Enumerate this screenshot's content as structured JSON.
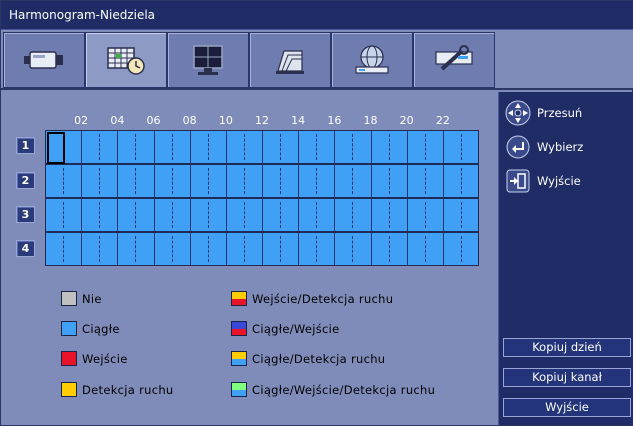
{
  "window": {
    "title": "Harmonogram-Niedziela"
  },
  "tabs": [
    {
      "icon": "camera-icon",
      "active": false
    },
    {
      "icon": "schedule-icon",
      "active": true
    },
    {
      "icon": "monitor-icon",
      "active": false
    },
    {
      "icon": "storage-icon",
      "active": false
    },
    {
      "icon": "network-icon",
      "active": false
    },
    {
      "icon": "tools-icon",
      "active": false
    }
  ],
  "schedule": {
    "hour_labels": [
      "02",
      "04",
      "06",
      "08",
      "10",
      "12",
      "14",
      "16",
      "18",
      "20",
      "22"
    ],
    "channels": [
      "1",
      "2",
      "3",
      "4"
    ],
    "fill_color": "#3fa0f5"
  },
  "legend": [
    {
      "label": "Nie",
      "colors": [
        "#c0c0c0"
      ]
    },
    {
      "label": "Ciągłe",
      "colors": [
        "#3fa0f5"
      ]
    },
    {
      "label": "Wejście",
      "colors": [
        "#e8142a"
      ]
    },
    {
      "label": "Detekcja  ruchu",
      "colors": [
        "#ffcc00"
      ]
    },
    {
      "label": "Wejście/Detekcja  ruchu",
      "colors": [
        "#e8142a",
        "#ffcc00"
      ]
    },
    {
      "label": "Ciągłe/Wejście",
      "colors": [
        "#e8142a",
        "#3a48d8"
      ]
    },
    {
      "label": "Ciągłe/Detekcja  ruchu",
      "colors": [
        "#3fa0f5",
        "#ffcc00"
      ]
    },
    {
      "label": "Ciągłe/Wejście/Detekcja  ruchu",
      "colors": [
        "#3fa0f5",
        "#80ff80"
      ]
    }
  ],
  "hints": {
    "move": "Przesuń",
    "select": "Wybierz",
    "exit": "Wyjście"
  },
  "buttons": {
    "copy_day": "Kopiuj  dzień",
    "copy_channel": "Kopiuj  kanał",
    "exit": "Wyjście"
  }
}
